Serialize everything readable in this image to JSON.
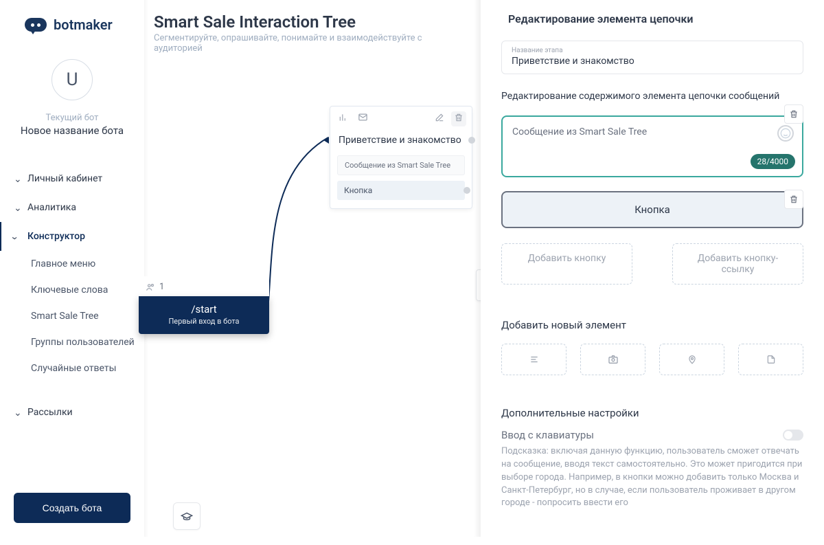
{
  "logo": {
    "text": "botmaker"
  },
  "bot": {
    "avatar_initial": "U",
    "current_label": "Текущий бот",
    "name": "Новое название бота"
  },
  "nav": {
    "personal": "Личный кабинет",
    "analytics": "Аналитика",
    "constructor": "Конструктор",
    "subs": {
      "main_menu": "Главное меню",
      "keywords": "Ключевые слова",
      "smart_tree": "Smart Sale Tree",
      "groups": "Группы пользователей",
      "random": "Случайные ответы"
    },
    "mailings": "Рассылки"
  },
  "create_bot": "Создать бота",
  "main": {
    "title": "Smart Sale Interaction Tree",
    "subtitle": "Сегментируйте, опрашивайте, понимайте и взаимодействуйте с аудиторией"
  },
  "start_node": {
    "count": "1",
    "title": "/start",
    "subtitle": "Первый вход в бота"
  },
  "step_node": {
    "title": "Приветствие и знакомство",
    "message": "Сообщение из Smart Sale Tree",
    "button": "Кнопка"
  },
  "rpanel": {
    "header": "Редактирование элемента цепочки",
    "stage_label": "Название этапа",
    "stage_value": "Приветствие и знакомство",
    "edit_content": "Редактирование содержимого элемента цепочки сообщений",
    "message": "Сообщение из Smart Sale Tree",
    "counter": "28/4000",
    "button_label": "Кнопка",
    "add_button": "Добавить кнопку",
    "add_link": "Добавить кнопку-ссылку",
    "add_element": "Добавить новый элемент",
    "extra_settings": "Дополнительные настройки",
    "keyboard_input": "Ввод с клавиатуры",
    "hint": "Подсказка: включая данную функцию, пользователь сможет отвечать на сообщение, вводя текст самостоятельно. Это может пригодится при выборе города. Например, в кнопки можно добавить только Москва и Санкт-Петербург, но в случае, если пользователь проживает в другом городе - попросить ввести его"
  }
}
